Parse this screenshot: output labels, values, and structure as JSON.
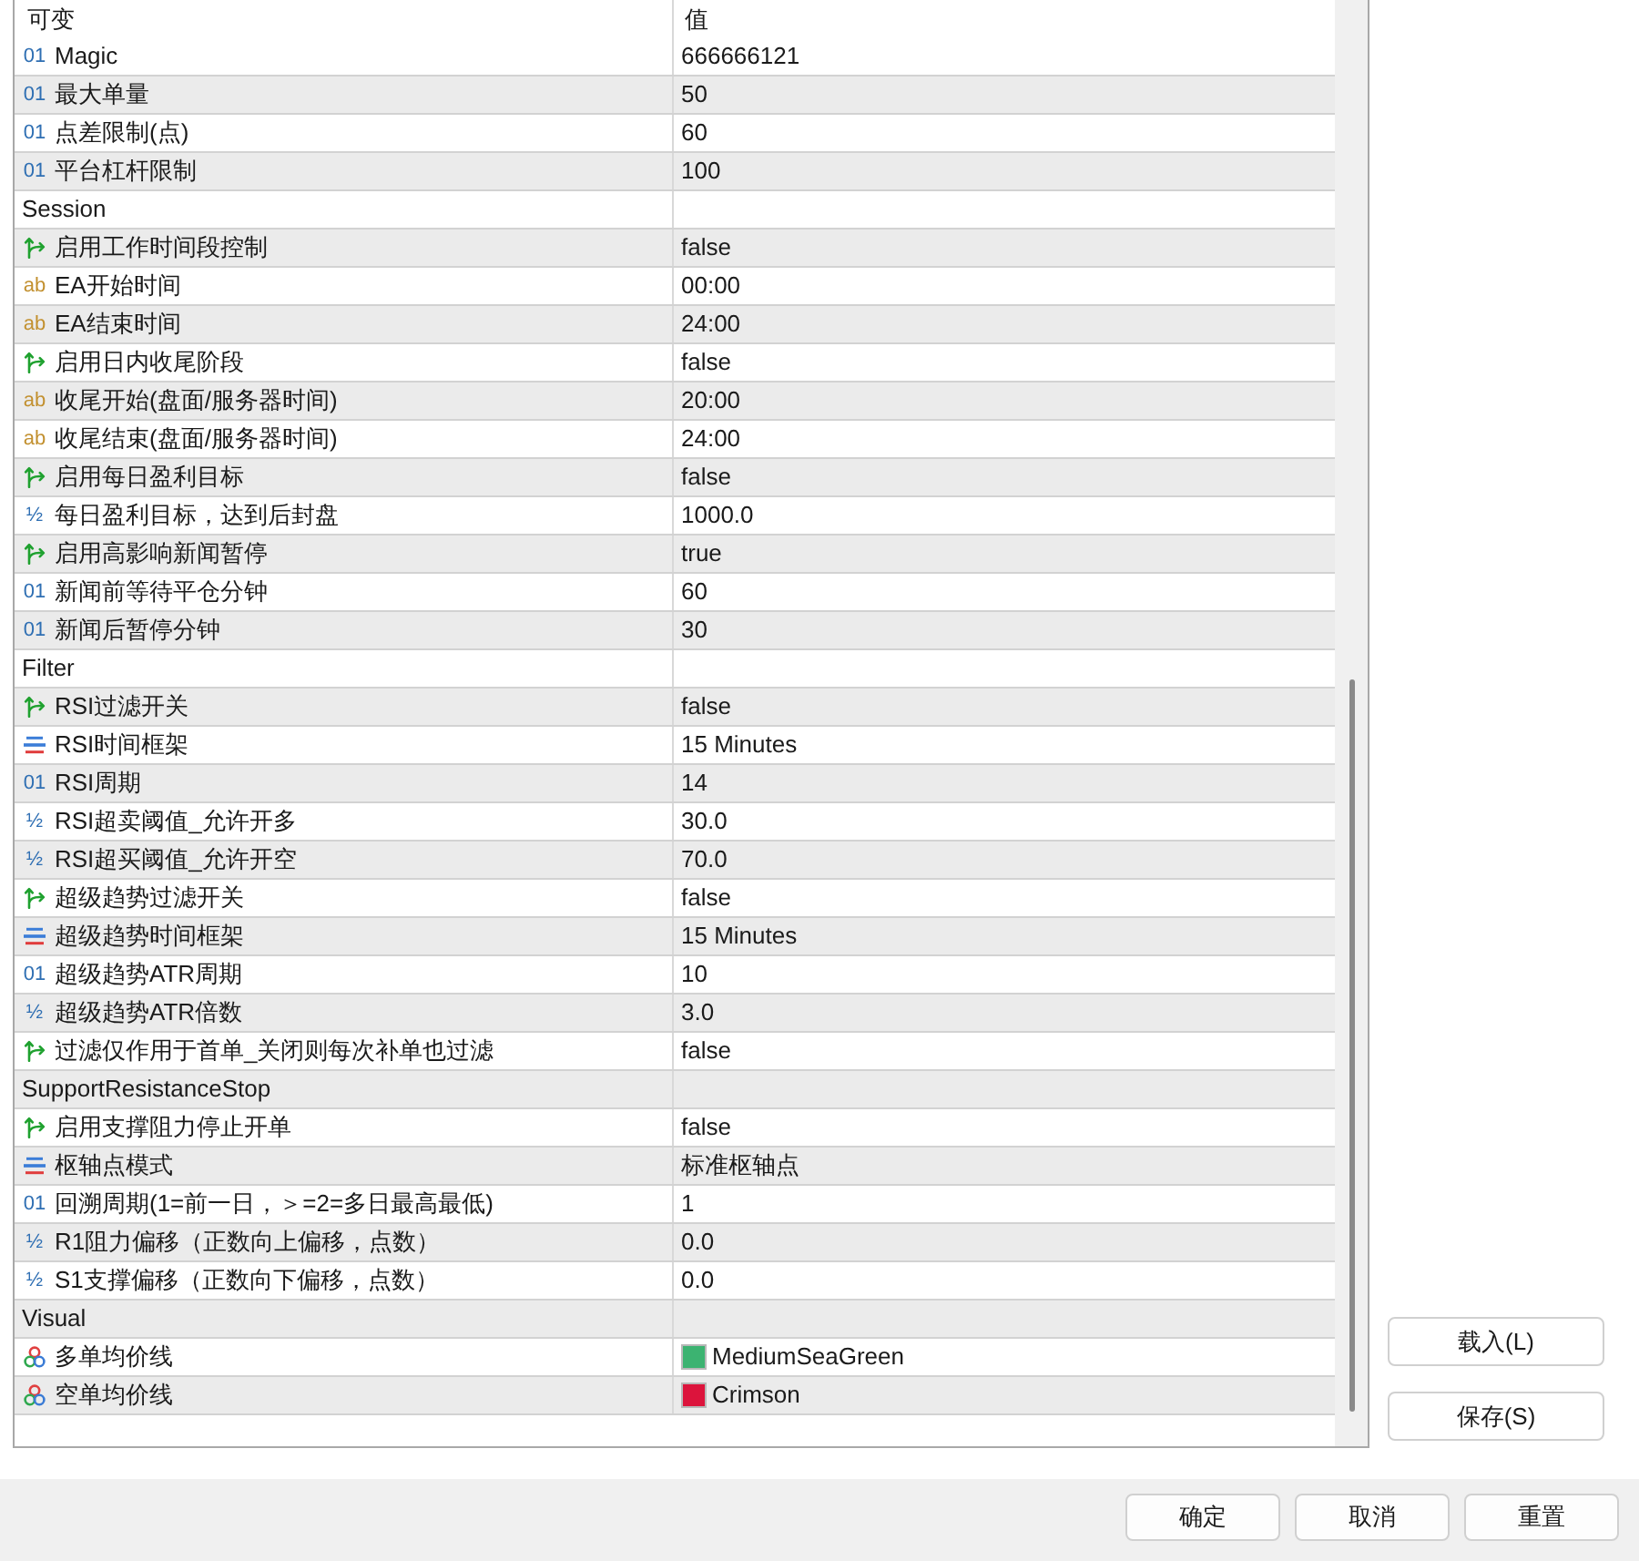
{
  "table": {
    "columns": [
      "可变",
      "值"
    ],
    "rows": [
      {
        "kind": "int",
        "type_icon": "01",
        "label": "Magic",
        "value": "666666121"
      },
      {
        "kind": "int",
        "type_icon": "01",
        "label": "最大单量",
        "value": "50"
      },
      {
        "kind": "int",
        "type_icon": "01",
        "label": "点差限制(点)",
        "value": "60"
      },
      {
        "kind": "int",
        "type_icon": "01",
        "label": "平台杠杆限制",
        "value": "100"
      },
      {
        "kind": "group",
        "label": "Session"
      },
      {
        "kind": "bool",
        "label": "启用工作时间段控制",
        "value": "false"
      },
      {
        "kind": "string",
        "type_icon": "ab",
        "label": "EA开始时间",
        "value": "00:00"
      },
      {
        "kind": "string",
        "type_icon": "ab",
        "label": "EA结束时间",
        "value": "24:00"
      },
      {
        "kind": "bool",
        "label": "启用日内收尾阶段",
        "value": "false"
      },
      {
        "kind": "string",
        "type_icon": "ab",
        "label": "收尾开始(盘面/服务器时间)",
        "value": "20:00"
      },
      {
        "kind": "string",
        "type_icon": "ab",
        "label": "收尾结束(盘面/服务器时间)",
        "value": "24:00"
      },
      {
        "kind": "bool",
        "label": "启用每日盈利目标",
        "value": "false"
      },
      {
        "kind": "double",
        "type_icon": "½",
        "label": "每日盈利目标，达到后封盘",
        "value": "1000.0"
      },
      {
        "kind": "bool",
        "label": "启用高影响新闻暂停",
        "value": "true"
      },
      {
        "kind": "int",
        "type_icon": "01",
        "label": "新闻前等待平仓分钟",
        "value": "60"
      },
      {
        "kind": "int",
        "type_icon": "01",
        "label": "新闻后暂停分钟",
        "value": "30"
      },
      {
        "kind": "group",
        "label": "Filter"
      },
      {
        "kind": "bool",
        "label": "RSI过滤开关",
        "value": "false"
      },
      {
        "kind": "enum",
        "label": "RSI时间框架",
        "value": "15 Minutes"
      },
      {
        "kind": "int",
        "type_icon": "01",
        "label": "RSI周期",
        "value": "14"
      },
      {
        "kind": "double",
        "type_icon": "½",
        "label": "RSI超卖阈值_允许开多",
        "value": "30.0"
      },
      {
        "kind": "double",
        "type_icon": "½",
        "label": "RSI超买阈值_允许开空",
        "value": "70.0"
      },
      {
        "kind": "bool",
        "label": "超级趋势过滤开关",
        "value": "false"
      },
      {
        "kind": "enum",
        "label": "超级趋势时间框架",
        "value": "15 Minutes"
      },
      {
        "kind": "int",
        "type_icon": "01",
        "label": "超级趋势ATR周期",
        "value": "10"
      },
      {
        "kind": "double",
        "type_icon": "½",
        "label": "超级趋势ATR倍数",
        "value": "3.0"
      },
      {
        "kind": "bool",
        "label": "过滤仅作用于首单_关闭则每次补单也过滤",
        "value": "false"
      },
      {
        "kind": "group",
        "label": "SupportResistanceStop"
      },
      {
        "kind": "bool",
        "label": "启用支撑阻力停止开单",
        "value": "false"
      },
      {
        "kind": "enum",
        "label": "枢轴点模式",
        "value": "标准枢轴点"
      },
      {
        "kind": "int",
        "type_icon": "01",
        "label": "回溯周期(1=前一日，＞=2=多日最高最低)",
        "value": "1"
      },
      {
        "kind": "double",
        "type_icon": "½",
        "label": "R1阻力偏移（正数向上偏移，点数）",
        "value": "0.0"
      },
      {
        "kind": "double",
        "type_icon": "½",
        "label": "S1支撑偏移（正数向下偏移，点数）",
        "value": "0.0"
      },
      {
        "kind": "group",
        "label": "Visual"
      },
      {
        "kind": "color",
        "label": "多单均价线",
        "value": "MediumSeaGreen",
        "color": "#3cb371"
      },
      {
        "kind": "color",
        "label": "空单均价线",
        "value": "Crimson",
        "color": "#dc143c"
      }
    ]
  },
  "side_buttons": [
    "载入(L)",
    "保存(S)"
  ],
  "dialog_buttons": [
    "确定",
    "取消",
    "重置"
  ]
}
